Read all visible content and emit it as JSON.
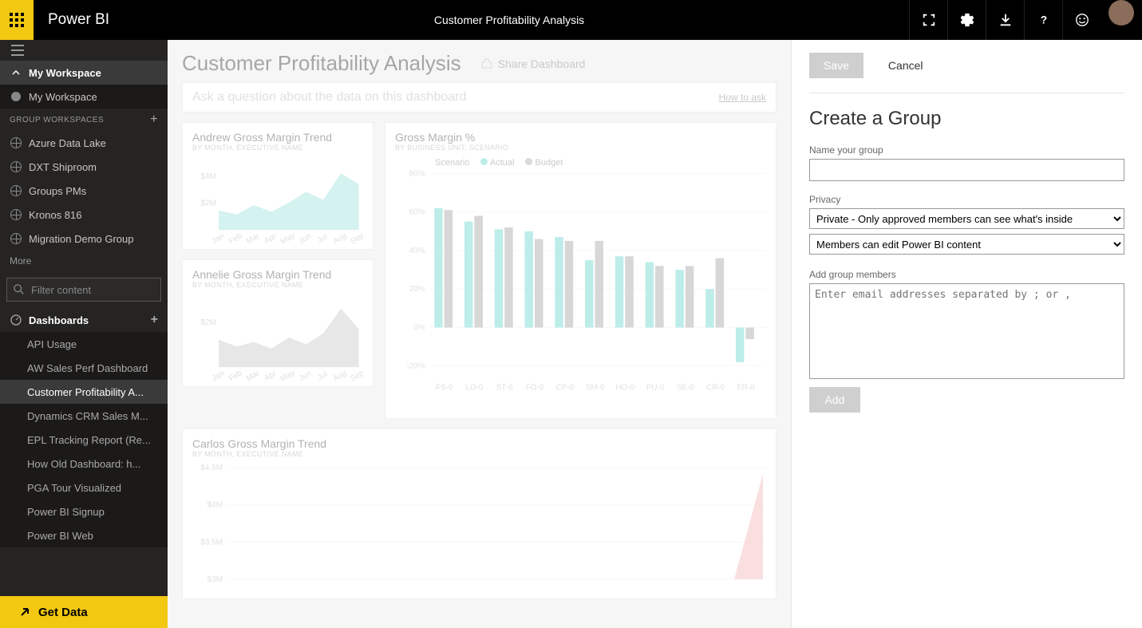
{
  "topbar": {
    "brand": "Power BI",
    "title": "Customer Profitability Analysis"
  },
  "sidebar": {
    "myworkspace_header": "My Workspace",
    "myworkspace_item": "My Workspace",
    "group_section": "GROUP WORKSPACES",
    "groups": [
      "Azure Data Lake",
      "DXT Shiproom",
      "Groups PMs",
      "Kronos 816",
      "Migration Demo Group"
    ],
    "more": "More",
    "filter_placeholder": "Filter content",
    "dashboards_header": "Dashboards",
    "dashboards": [
      "API Usage",
      "AW Sales Perf Dashboard",
      "Customer Profitability A...",
      "Dynamics CRM Sales M...",
      "EPL Tracking Report (Re...",
      "How Old Dashboard: h...",
      "PGA Tour Visualized",
      "Power BI Signup",
      "Power BI Web"
    ],
    "get_data": "Get Data"
  },
  "main": {
    "title": "Customer Profitability Analysis",
    "share": "Share Dashboard",
    "qa_placeholder": "Ask a question about the data on this dashboard",
    "howto": "How to ask",
    "tiles": {
      "andrew": {
        "title": "Andrew Gross Margin Trend",
        "sub": "BY MONTH, EXECUTIVE NAME"
      },
      "annelie": {
        "title": "Annelie Gross Margin Trend",
        "sub": "BY MONTH, EXECUTIVE NAME"
      },
      "carlos": {
        "title": "Carlos Gross Margin Trend",
        "sub": "BY MONTH, EXECUTIVE NAME"
      },
      "gm": {
        "title": "Gross Margin %",
        "sub": "BY BUSINESS UNIT, SCENARIO",
        "legend_label": "Scenario",
        "legend_a": "Actual",
        "legend_b": "Budget"
      }
    }
  },
  "panel": {
    "save": "Save",
    "cancel": "Cancel",
    "title": "Create a Group",
    "name_label": "Name your group",
    "privacy_label": "Privacy",
    "privacy_option": "Private - Only approved members can see what's inside",
    "perm_option": "Members can edit Power BI content",
    "members_label": "Add group members",
    "members_placeholder": "Enter email addresses separated by ; or ,",
    "add": "Add"
  },
  "chart_data": [
    {
      "id": "andrew",
      "type": "area",
      "x": [
        "Jan",
        "Feb",
        "Mar",
        "Apr",
        "May",
        "Jun",
        "Jul",
        "Aug",
        "Sep"
      ],
      "y": [
        1.4,
        1.1,
        1.8,
        1.3,
        2.0,
        2.8,
        2.2,
        4.2,
        3.4
      ],
      "ylabel_ticks": [
        "$2M",
        "$4M"
      ],
      "ylim": [
        0,
        5
      ],
      "color": "#9fe3dc"
    },
    {
      "id": "annelie",
      "type": "area",
      "x": [
        "Jan",
        "Feb",
        "Mar",
        "Apr",
        "May",
        "Jun",
        "Jul",
        "Aug",
        "Sep"
      ],
      "y": [
        1.2,
        0.9,
        1.1,
        0.8,
        1.3,
        1.0,
        1.5,
        2.6,
        1.7
      ],
      "ylabel_ticks": [
        "$2M"
      ],
      "ylim": [
        0,
        3
      ],
      "color": "#c9c9c9"
    },
    {
      "id": "carlos",
      "type": "area",
      "x": [],
      "y": [],
      "ylabel_ticks": [
        "$3M",
        "$3.5M",
        "$4M",
        "$4.5M"
      ],
      "ylim": [
        2.5,
        5
      ],
      "color": "#f4b8b8"
    },
    {
      "id": "gm",
      "type": "bar",
      "categories": [
        "FS-0",
        "LO-0",
        "ST-0",
        "FO-0",
        "CP-0",
        "SM-0",
        "HO-0",
        "PU-0",
        "SE-0",
        "CR-0",
        "ER-0"
      ],
      "series": [
        {
          "name": "Actual",
          "color": "#6dd7cf",
          "values": [
            62,
            55,
            51,
            50,
            47,
            35,
            37,
            34,
            30,
            20,
            -18
          ]
        },
        {
          "name": "Budget",
          "color": "#a6a6a6",
          "values": [
            61,
            58,
            52,
            46,
            45,
            45,
            37,
            32,
            32,
            36,
            -6
          ]
        }
      ],
      "yticks": [
        "-20%",
        "0%",
        "20%",
        "40%",
        "60%",
        "80%"
      ],
      "ylim": [
        -25,
        80
      ]
    }
  ]
}
